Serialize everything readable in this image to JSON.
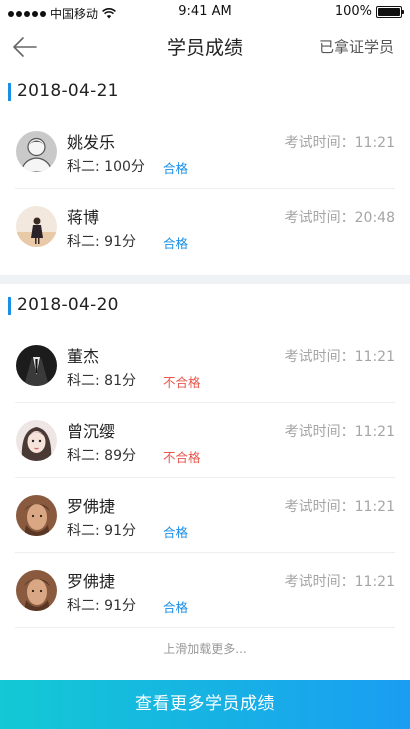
{
  "status_bar": {
    "carrier": "中国移动",
    "time": "9:41 AM",
    "battery": "100%"
  },
  "nav": {
    "title": "学员成绩",
    "right_action": "已拿证学员",
    "back_icon": "arrow-left-icon"
  },
  "sections": [
    {
      "date": "2018-04-21",
      "students": [
        {
          "name": "姚发乐",
          "score": "科二: 100分",
          "result": "合格",
          "status": "pass",
          "exam_time": "考试时间：11:21",
          "avatar": "default-avatar"
        },
        {
          "name": "蒋博",
          "score": "科二: 91分",
          "result": "合格",
          "status": "pass",
          "exam_time": "考试时间：20:48",
          "avatar": "photo-avatar"
        }
      ]
    },
    {
      "date": "2018-04-20",
      "students": [
        {
          "name": "董杰",
          "score": "科二: 81分",
          "result": "不合格",
          "status": "fail",
          "exam_time": "考试时间：11:21",
          "avatar": "photo-avatar"
        },
        {
          "name": "曾沉缨",
          "score": "科二: 89分",
          "result": "不合格",
          "status": "fail",
          "exam_time": "考试时间：11:21",
          "avatar": "photo-avatar"
        },
        {
          "name": "罗佛捷",
          "score": "科二: 91分",
          "result": "合格",
          "status": "pass",
          "exam_time": "考试时间：11:21",
          "avatar": "photo-avatar"
        },
        {
          "name": "罗佛捷",
          "score": "科二: 91分",
          "result": "合格",
          "status": "pass",
          "exam_time": "考试时间：11:21",
          "avatar": "photo-avatar"
        }
      ]
    }
  ],
  "load_more": "上滑加载更多...",
  "bottom_button": "查看更多学员成绩",
  "colors": {
    "accent": "#1a8fe8",
    "fail": "#e8574f",
    "button_gradient_start": "#13c9d4",
    "button_gradient_end": "#1a9df2"
  }
}
